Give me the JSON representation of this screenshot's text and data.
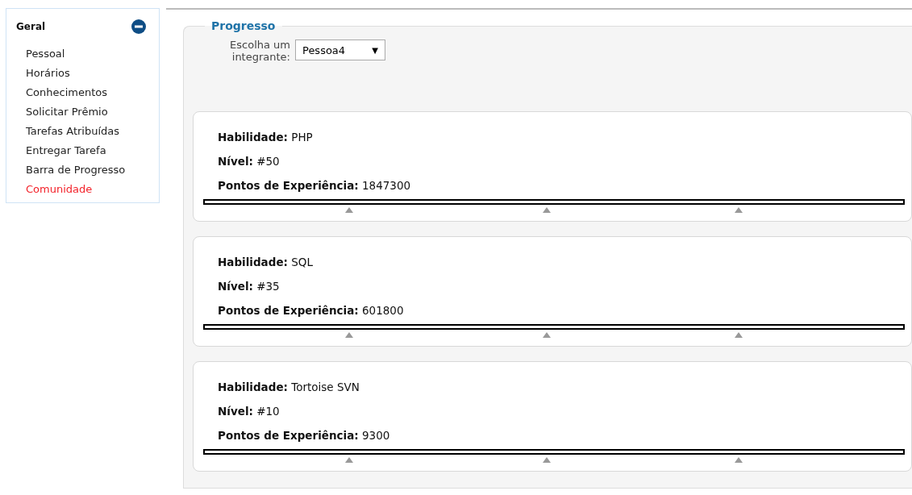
{
  "sidebar": {
    "title": "Geral",
    "expanded": true,
    "items": [
      {
        "label": "Pessoal",
        "selected": false
      },
      {
        "label": "Horários",
        "selected": false
      },
      {
        "label": "Conhecimentos",
        "selected": false
      },
      {
        "label": "Solicitar Prêmio",
        "selected": false
      },
      {
        "label": "Tarefas Atribuídas",
        "selected": false
      },
      {
        "label": "Entregar Tarefa",
        "selected": false
      },
      {
        "label": "Barra de Progresso",
        "selected": false
      },
      {
        "label": "Comunidade",
        "selected": true
      }
    ]
  },
  "panel": {
    "legend": "Progresso",
    "select_label": "Escolha um integrante:",
    "select_value": "Pessoa4",
    "select_arrow": "▼",
    "cards": [
      {
        "skill_label": "Habilidade:",
        "skill": "PHP",
        "level_label": "Nível:",
        "level_value": "#50",
        "xp_label": "Pontos de Experiência:",
        "xp": "1847300",
        "level": 0
      },
      {
        "skill_label": "Habilidade:",
        "skill": "SQL",
        "level_label": "Nível:",
        "level_value": "#35",
        "xp_label": "Pontos de Experiência:",
        "xp": "601800",
        "level": 0
      },
      {
        "skill_label": "Habilidade:",
        "skill": "Tortoise SVN",
        "level_label": "Nível:",
        "level_value": "#10",
        "xp_label": "Pontos de Experiência:",
        "xp": "9300",
        "level": 0
      }
    ]
  }
}
